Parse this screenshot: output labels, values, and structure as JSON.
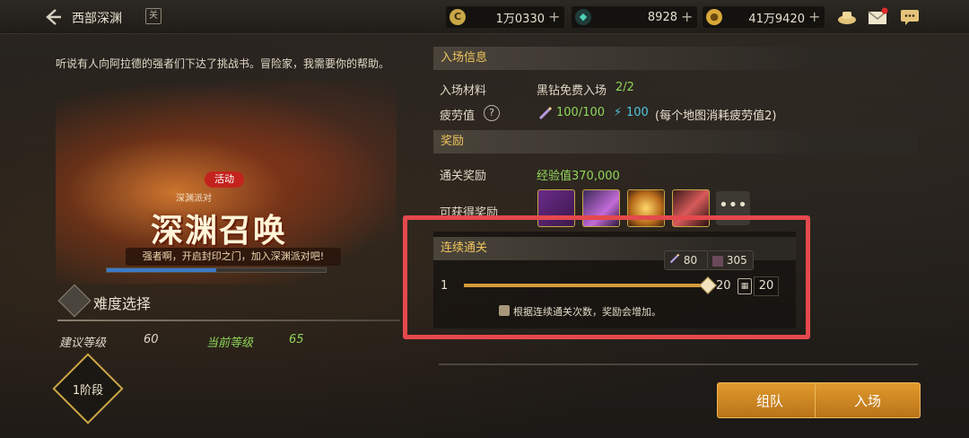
{
  "topbar": {
    "title": "西部深渊",
    "map_icon": "关",
    "currencies": [
      {
        "icon": "C",
        "value": "1万0330",
        "plus": "+"
      },
      {
        "icon": "◆",
        "value": "8928",
        "plus": "+"
      },
      {
        "icon": "●",
        "value": "41万9420",
        "plus": "+"
      }
    ],
    "icons": [
      "treasure-icon",
      "mail-icon",
      "chat-icon"
    ]
  },
  "left": {
    "intro": "听说有人向阿拉德的强者们下达了挑战书。冒险家，我需要你的帮助。",
    "badge": "活动",
    "small_subtitle": "深渊派对",
    "banner_title": "深渊召唤",
    "banner_strip": "强者啊，开启封印之门，加入深渊派对吧!",
    "progress_percent": 50,
    "difficulty_label": "难度选择",
    "recommended_label": "建议等级",
    "recommended_value": "60",
    "current_label": "当前等级",
    "current_value": "65",
    "stage_label": "1阶段"
  },
  "entry": {
    "section_title": "入场信息",
    "material_label": "入场材料",
    "material_value": "黑钻免费入场",
    "material_count": "2/2",
    "fatigue_label": "疲劳值",
    "fatigue_value": "100/100",
    "bolt_value": "100",
    "fatigue_note": "(每个地图消耗疲劳值2)"
  },
  "reward": {
    "section_title": "奖励",
    "clear_label": "通关奖励",
    "clear_value": "经验值370,000",
    "possible_label": "可获得奖励",
    "more_label": "•••"
  },
  "continuous": {
    "section_title": "连续通关",
    "chip_fatigue": "80",
    "chip_item": "305",
    "min_label": "1",
    "max_label": "20",
    "count": "20",
    "slider_fraction": 1.0,
    "hint": "根据连续通关次数，奖励会增加。"
  },
  "buttons": {
    "team": "组队",
    "enter": "入场"
  },
  "colors": {
    "accent": "#f0c45c",
    "green": "#8fd65a",
    "cyan": "#4fc6e0",
    "button": "#d78a26",
    "highlight": "#e5494d"
  }
}
